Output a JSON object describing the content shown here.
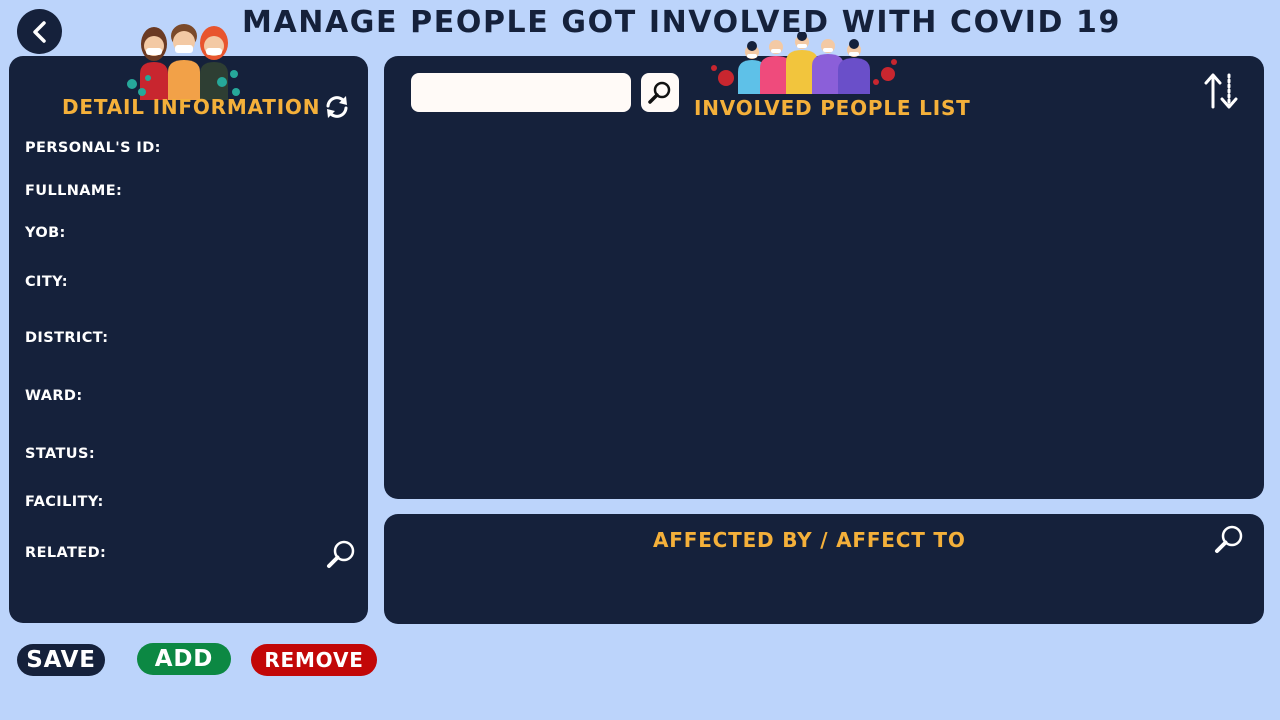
{
  "header": {
    "title": "MANAGE PEOPLE GOT INVOLVED WITH COVID 19",
    "back_icon": "chevron-left-icon"
  },
  "detail": {
    "title": "DETAIL INFORMATION",
    "refresh_icon": "refresh-icon",
    "fields": [
      {
        "label": "PERSONAL'S ID:"
      },
      {
        "label": "FULLNAME:"
      },
      {
        "label": "YOB:"
      },
      {
        "label": "CITY:"
      },
      {
        "label": "DISTRICT:"
      },
      {
        "label": "WARD:"
      },
      {
        "label": "STATUS:"
      },
      {
        "label": "FACILITY:"
      },
      {
        "label": "RELATED:"
      }
    ],
    "related_search_icon": "search-icon"
  },
  "list": {
    "title": "INVOLVED PEOPLE LIST",
    "search_value": "",
    "search_icon": "search-icon",
    "sort_icon": "sort-icon"
  },
  "affect": {
    "title": "AFFECTED BY / AFFECT TO",
    "search_icon": "search-icon"
  },
  "actions": {
    "save_label": "SAVE",
    "add_label": "ADD",
    "remove_label": "REMOVE"
  },
  "colors": {
    "background": "#bcd4fb",
    "panel": "#15213b",
    "accent": "#f4b03a",
    "add": "#0c8843",
    "remove": "#c20707"
  }
}
